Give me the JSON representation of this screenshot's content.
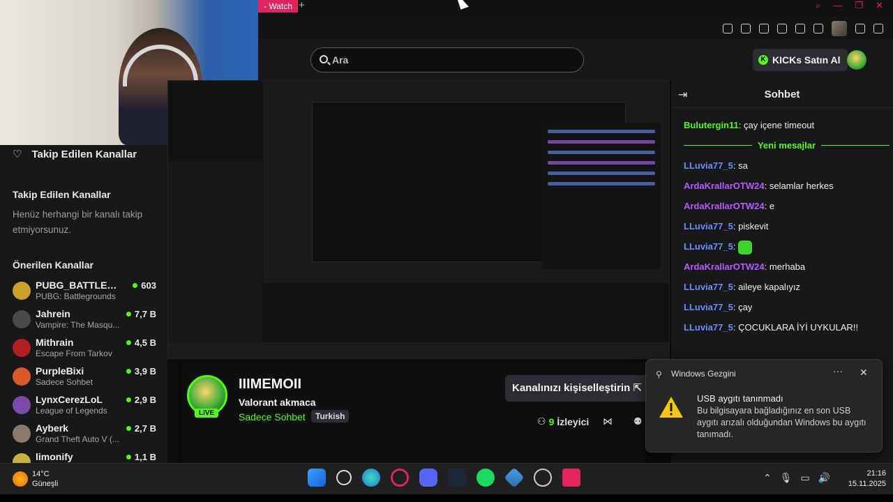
{
  "browser": {
    "tab_label": "- Watch",
    "new_tab": "+"
  },
  "header": {
    "search_placeholder": "Ara",
    "kicks_button": "KICKs Satın Al"
  },
  "sidebar": {
    "followed_title": "Takip Edilen Kanallar",
    "followed_heading": "Takip Edilen Kanallar",
    "followed_empty": "Henüz herhangi bir kanalı takip etmiyorsunuz.",
    "recommended_heading": "Önerilen Kanallar",
    "channels": [
      {
        "name": "PUBG_BATTLEGR...",
        "game": "PUBG: Battlegrounds",
        "viewers": "603",
        "color": "#c9a227"
      },
      {
        "name": "Jahrein",
        "game": "Vampire: The Masqu...",
        "viewers": "7,7 B",
        "color": "#4a4a4a"
      },
      {
        "name": "Mithrain",
        "game": "Escape From Tarkov",
        "viewers": "4,5 B",
        "color": "#b02020"
      },
      {
        "name": "PurpleBixi",
        "game": "Sadece Sohbet",
        "viewers": "3,9 B",
        "color": "#d85a2a"
      },
      {
        "name": "LynxCerezLoL",
        "game": "League of Legends",
        "viewers": "2,9 B",
        "color": "#7a4aa8"
      },
      {
        "name": "Ayberk",
        "game": "Grand Theft Auto V (...",
        "viewers": "2,7 B",
        "color": "#8a7a6a"
      },
      {
        "name": "limonify",
        "game": "",
        "viewers": "1,1 B",
        "color": "#c8b040"
      }
    ]
  },
  "channel": {
    "title": "IIIMEMOII",
    "stream_title": "Valorant akmaca",
    "category": "Sadece Sohbet",
    "language": "Turkish",
    "live_badge": "LIVE",
    "customize_button": "Kanalınızı kişiselleştirin",
    "viewers_count": "9",
    "viewers_label": "İzleyici"
  },
  "chat": {
    "title": "Sohbet",
    "new_messages": "Yeni mesajlar",
    "messages": [
      {
        "user": "Bulutergin11",
        "text": "çay içene timeout",
        "color": "#53fc18"
      },
      {
        "user": "LLuvia77_5",
        "text": "sa",
        "color": "#6b8cff"
      },
      {
        "user": "ArdaKrallarOTW24",
        "text": "selamlar herkes",
        "color": "#b35bff"
      },
      {
        "user": "ArdaKrallarOTW24",
        "text": "e",
        "color": "#b35bff"
      },
      {
        "user": "LLuvia77_5",
        "text": "piskevit",
        "color": "#6b8cff"
      },
      {
        "user": "LLuvia77_5",
        "text": "",
        "color": "#6b8cff",
        "emote": true
      },
      {
        "user": "ArdaKrallarOTW24",
        "text": "merhaba",
        "color": "#b35bff"
      },
      {
        "user": "LLuvia77_5",
        "text": "aileye kapalıyız",
        "color": "#6b8cff"
      },
      {
        "user": "LLuvia77_5",
        "text": "çay",
        "color": "#6b8cff"
      },
      {
        "user": "LLuvia77_5",
        "text": "ÇOCUKLARA İYİ UYKULAR!!",
        "color": "#6b8cff"
      }
    ]
  },
  "notification": {
    "app": "Windows Gezgini",
    "title": "USB aygıtı tanınmadı",
    "body": "Bu bilgisayara bağladığınız en son USB aygıtı arızalı olduğundan Windows bu aygıtı tanımadı."
  },
  "taskbar": {
    "weather_temp": "14°C",
    "weather_desc": "Güneşli",
    "time": "21:16",
    "date": "15.11.2025"
  },
  "colors": {
    "accent": "#53fc18",
    "tab": "#e0245e"
  }
}
